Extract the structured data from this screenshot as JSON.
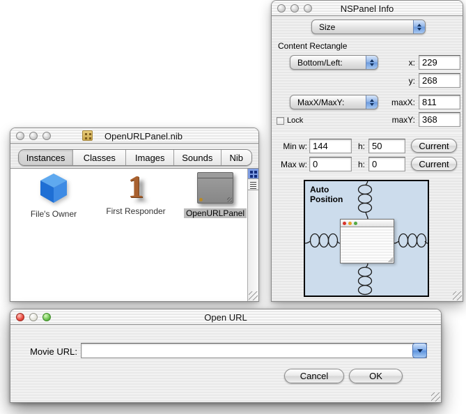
{
  "colors": {
    "accent_blue": "#5B8FD8",
    "auto_position_bg": "#CCDCEC",
    "selection_gray": "#BCBCBC",
    "panel_stripe": "#ECECEC"
  },
  "inspector": {
    "window_title": "NSPanel Info",
    "mode_popup_value": "Size",
    "content_rectangle_label": "Content Rectangle",
    "origin_popup_value": "Bottom/Left:",
    "x_label": "x:",
    "x_value": "229",
    "y_label": "y:",
    "y_value": "268",
    "max_popup_value": "MaxX/MaxY:",
    "maxx_label": "maxX:",
    "maxx_value": "811",
    "maxy_label": "maxY:",
    "maxy_value": "368",
    "lock_label": "Lock",
    "min_w_label": "Min w:",
    "min_w_value": "144",
    "min_h_label": "h:",
    "min_h_value": "50",
    "max_w_label": "Max w:",
    "max_w_value": "0",
    "max_h_label": "h:",
    "max_h_value": "0",
    "current_button_label": "Current",
    "auto_position_label": "Auto Position"
  },
  "nib": {
    "window_title": "OpenURLPanel.nib",
    "tabs": [
      {
        "label": "Instances"
      },
      {
        "label": "Classes"
      },
      {
        "label": "Images"
      },
      {
        "label": "Sounds"
      },
      {
        "label": "Nib"
      }
    ],
    "selected_tab": "Instances",
    "items": [
      {
        "label": "File's Owner"
      },
      {
        "label": "First Responder"
      },
      {
        "label": "OpenURLPanel"
      }
    ],
    "selected_item": "OpenURLPanel"
  },
  "open_url": {
    "window_title": "Open URL",
    "movie_url_label": "Movie URL:",
    "movie_url_value": "",
    "cancel_button_label": "Cancel",
    "ok_button_label": "OK"
  }
}
